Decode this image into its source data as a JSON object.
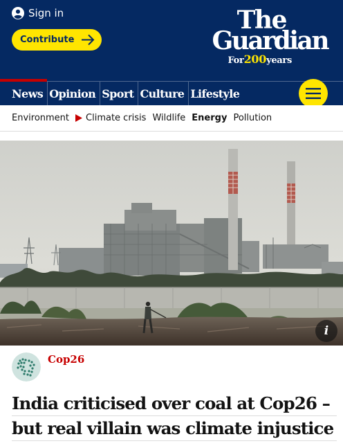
{
  "header": {
    "signin_label": "Sign in",
    "contribute_label": "Contribute",
    "logo": {
      "line1": "The",
      "line2": "Guardian",
      "tagline_prefix": "For",
      "tagline_number": "200",
      "tagline_suffix": "years"
    },
    "pillars": [
      {
        "label": "News"
      },
      {
        "label": "Opinion"
      },
      {
        "label": "Sport"
      },
      {
        "label": "Culture"
      },
      {
        "label": "Lifestyle"
      }
    ],
    "menu_icon": "hamburger-icon"
  },
  "subnav": {
    "items": [
      {
        "label": "Environment"
      },
      {
        "label": "Climate crisis"
      },
      {
        "label": "Wildlife"
      },
      {
        "label": "Energy"
      },
      {
        "label": "Pollution"
      }
    ]
  },
  "hero": {
    "info_label": "i"
  },
  "article": {
    "series": "Cop26",
    "headline_line1": "India criticised over coal at Cop26 –",
    "headline_line2": "but real villain was climate injustice"
  },
  "colors": {
    "brand_blue": "#052962",
    "contribute_yellow": "#ffe500",
    "news_red": "#c70000",
    "text": "#121212"
  }
}
